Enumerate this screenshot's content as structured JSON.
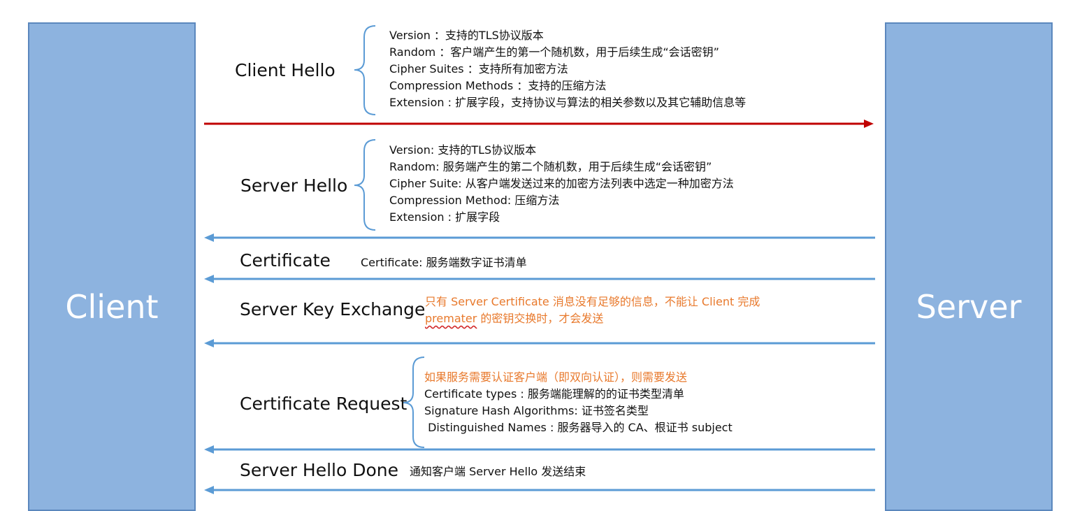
{
  "client": {
    "label": "Client"
  },
  "server": {
    "label": "Server"
  },
  "steps": {
    "client_hello": {
      "title": "Client Hello",
      "lines": [
        "Version ：支持的TLS协议版本",
        "Random ：客户端产生的第一个随机数，用于后续生成“会话密钥”",
        "Cipher Suites ：支持所有加密方法",
        "Compression Methods ：支持的压缩方法",
        "Extension : 扩展字段，支持协议与算法的相关参数以及其它辅助信息等"
      ]
    },
    "server_hello": {
      "title": "Server Hello",
      "lines": [
        "Version: 支持的TLS协议版本",
        "Random: 服务端产生的第二个随机数，用于后续生成“会话密钥”",
        "Cipher Suite: 从客户端发送过来的加密方法列表中选定一种加密方法",
        "Compression Method: 压缩方法",
        "Extension : 扩展字段"
      ]
    },
    "certificate": {
      "title": "Certificate",
      "desc": "Certificate: 服务端数字证书清单"
    },
    "server_key_exchange": {
      "title": "Server Key Exchange",
      "note_line1": "只有 Server Certificate 消息没有足够的信息，不能让 Client 完成",
      "note_line2_word": "premater",
      "note_line2_rest": " 的密钥交换时，才会发送"
    },
    "certificate_request": {
      "title": "Certificate Request",
      "note": "如果服务需要认证客户端（即双向认证），则需要发送",
      "lines": [
        "Certificate types : 服务端能理解的的证书类型清单",
        "Signature Hash Algorithms: 证书签名类型",
        " Distinguished Names : 服务器导入的 CA、根证书 subject"
      ]
    },
    "server_hello_done": {
      "title": "Server Hello Done",
      "desc": "通知客户端 Server Hello 发送结束"
    }
  },
  "colors": {
    "pillar_fill": "#8db3df",
    "pillar_border": "#5b87bd",
    "client_arrow": "#c00000",
    "server_arrow": "#5b9bd5",
    "note_text": "#e8792c"
  }
}
